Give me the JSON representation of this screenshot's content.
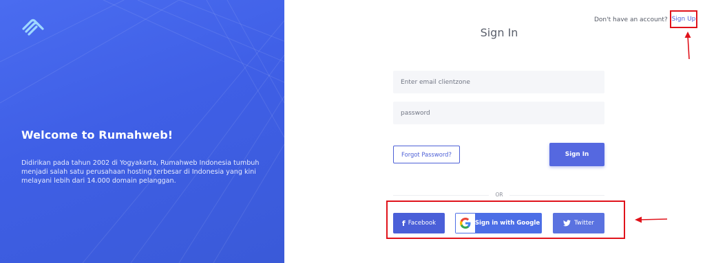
{
  "brand": {
    "logo_icon": "rumahweb-logo-icon",
    "welcome_title": "Welcome to Rumahweb!",
    "description": "Didirikan pada tahun 2002 di Yogyakarta, Rumahweb Indonesia tumbuh menjadi salah satu perusahaan hosting terbesar di Indonesia yang kini melayani lebih dari 14.000 domain pelanggan."
  },
  "header": {
    "account_question": "Don't have an account?",
    "signup_label": "Sign Up"
  },
  "form": {
    "title": "Sign In",
    "email_placeholder": "Enter email clientzone",
    "email_value": "",
    "password_placeholder": "password",
    "password_value": "",
    "forgot_label": "Forgot Password?",
    "signin_label": "Sign In",
    "or_label": "OR"
  },
  "social": {
    "facebook_label": "Facebook",
    "google_label": "Sign in with Google",
    "twitter_label": "Twitter"
  },
  "colors": {
    "brand_blue": "#3f5fe6",
    "accent": "#5568e0",
    "annotation_red": "#e0121a"
  }
}
